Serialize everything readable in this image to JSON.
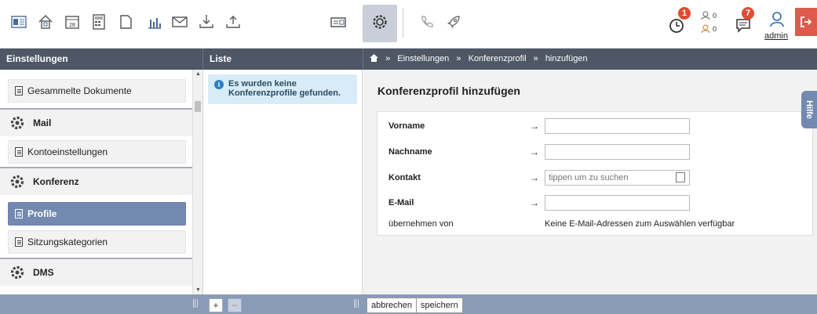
{
  "toolbar": {
    "icons": [
      "address-card-icon",
      "home-icon",
      "calendar-icon",
      "calculator-icon",
      "document-icon",
      "chart-icon",
      "envelope-icon",
      "download-icon",
      "upload-icon",
      "card-icon",
      "settings-icon",
      "phone-icon",
      "rocket-icon"
    ],
    "calendar_day": "28",
    "timer_badge": "1",
    "messages_badge": "7",
    "counter_a": "0",
    "counter_b": "0",
    "user": "admin"
  },
  "headers": {
    "left": "Einstellungen",
    "middle": "Liste",
    "breadcrumb": [
      "Einstellungen",
      "Konferenzprofil",
      "hinzufügen"
    ]
  },
  "sidebar": {
    "items": [
      {
        "label": "Gesammelte Dokumente",
        "type": "item"
      },
      {
        "label": "Mail",
        "type": "section"
      },
      {
        "label": "Kontoeinstellungen",
        "type": "item"
      },
      {
        "label": "Konferenz",
        "type": "section"
      },
      {
        "label": "Profile",
        "type": "item",
        "active": true
      },
      {
        "label": "Sitzungskategorien",
        "type": "item"
      },
      {
        "label": "DMS",
        "type": "section"
      }
    ]
  },
  "list": {
    "empty_message": "Es wurden keine Konferenzprofile gefunden."
  },
  "form": {
    "title": "Konferenzprofil hinzufügen",
    "fields": {
      "vorname": {
        "label": "Vorname",
        "value": ""
      },
      "nachname": {
        "label": "Nachname",
        "value": ""
      },
      "kontakt": {
        "label": "Kontakt",
        "value": "",
        "placeholder": "tippen um zu suchen"
      },
      "email": {
        "label": "E-Mail",
        "value": ""
      }
    },
    "uebernehmen": {
      "label": "übernehmen von",
      "value": "Keine E-Mail-Adressen zum Auswählen verfügbar"
    },
    "arrow": "→"
  },
  "help_tab": "Hilfe",
  "bottom": {
    "add": "+",
    "remove": "−",
    "cancel": "abbrechen",
    "save": "speichern"
  },
  "colors": {
    "header_bg": "#4d5766",
    "accent": "#7389b0",
    "bottom_bar": "#8a9bb8",
    "badge": "#e24a33",
    "logout": "#e05a4e"
  }
}
